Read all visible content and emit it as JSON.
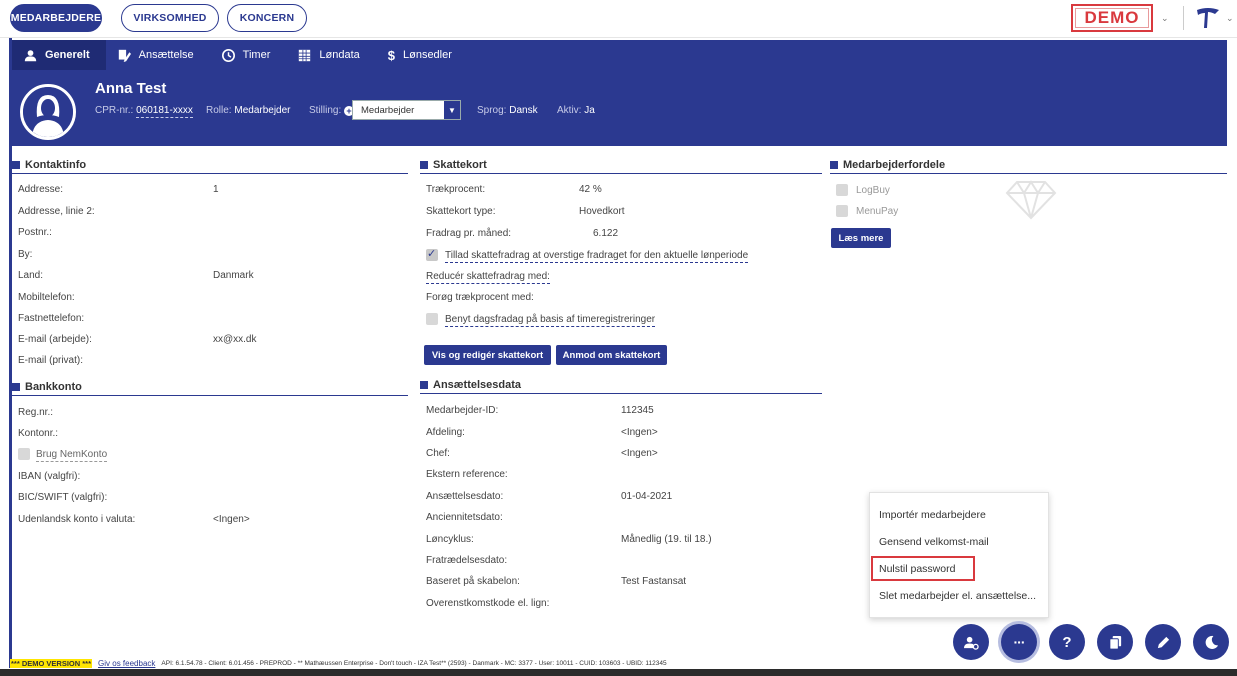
{
  "top_tabs": [
    {
      "label": "MEDARBEJDERE",
      "active": true
    },
    {
      "label": "VIRKSOMHED",
      "active": false
    },
    {
      "label": "KONCERN",
      "active": false
    }
  ],
  "demo_badge": "DEMO",
  "brand_color": "#2b3990",
  "highlight_color": "#d9393e",
  "tabs": [
    {
      "label": "Generelt",
      "icon": "user-icon",
      "active": true
    },
    {
      "label": "Ansættelse",
      "icon": "edit-document-icon",
      "active": false
    },
    {
      "label": "Timer",
      "icon": "clock-icon",
      "active": false
    },
    {
      "label": "Løndata",
      "icon": "table-icon",
      "active": false
    },
    {
      "label": "Lønsedler",
      "icon": "dollar-icon",
      "active": false
    }
  ],
  "employee": {
    "name": "Anna Test",
    "cpr_label": "CPR-nr.:",
    "cpr_value": "060181-xxxx",
    "rolle_label": "Rolle:",
    "rolle_value": "Medarbejder",
    "stilling_label": "Stilling:",
    "stilling_value": "Medarbejder",
    "sprog_label": "Sprog:",
    "sprog_value": "Dansk",
    "aktiv_label": "Aktiv:",
    "aktiv_value": "Ja"
  },
  "kontaktinfo": {
    "title": "Kontaktinfo",
    "rows": [
      {
        "label": "Addresse:",
        "value": "1"
      },
      {
        "label": "Addresse, linie 2:",
        "value": ""
      },
      {
        "label": "Postnr.:",
        "value": ""
      },
      {
        "label": "By:",
        "value": ""
      },
      {
        "label": "Land:",
        "value": "Danmark"
      },
      {
        "label": "Mobiltelefon:",
        "value": ""
      },
      {
        "label": "Fastnettelefon:",
        "value": ""
      },
      {
        "label": "E-mail (arbejde):",
        "value": "xx@xx.dk"
      },
      {
        "label": "E-mail (privat):",
        "value": ""
      }
    ]
  },
  "bankkonto": {
    "title": "Bankkonto",
    "regnr": "Reg.nr.:",
    "kontonr": "Kontonr.:",
    "nemkonto": "Brug NemKonto",
    "iban": "IBAN (valgfri):",
    "bic": "BIC/SWIFT (valgfri):",
    "udenlandsk_label": "Udenlandsk konto i valuta:",
    "udenlandsk_value": "<Ingen>"
  },
  "skattekort": {
    "title": "Skattekort",
    "traek_label": "Trækprocent:",
    "traek_value": "42 %",
    "type_label": "Skattekort type:",
    "type_value": "Hovedkort",
    "fradrag_label": "Fradrag pr. måned:",
    "fradrag_value": "6.122",
    "tillad": "Tillad skattefradrag at overstige fradraget for den aktuelle lønperiode",
    "reducer": "Reducér skattefradrag med:",
    "forog": "Forøg trækprocent med:",
    "benyt": "Benyt dagsfradag på basis af timeregistreringer",
    "btn_vis": "Vis og redigér skattekort",
    "btn_anmod": "Anmod om skattekort"
  },
  "ansaettelse": {
    "title": "Ansættelsesdata",
    "rows": [
      {
        "label": "Medarbejder-ID:",
        "value": "112345"
      },
      {
        "label": "Afdeling:",
        "value": "<Ingen>"
      },
      {
        "label": "Chef:",
        "value": "<Ingen>"
      },
      {
        "label": "Ekstern reference:",
        "value": ""
      },
      {
        "label": "Ansættelsesdato:",
        "value": "01-04-2021"
      },
      {
        "label": "Anciennitetsdato:",
        "value": ""
      },
      {
        "label": "Løncyklus:",
        "value": "Månedlig (19. til 18.)"
      },
      {
        "label": "Fratrædelsesdato:",
        "value": ""
      },
      {
        "label": "Baseret på skabelon:",
        "value": "Test Fastansat"
      },
      {
        "label": "Overenstkomstkode el. lign:",
        "value": ""
      }
    ]
  },
  "fordele": {
    "title": "Medarbejderfordele",
    "items": [
      "LogBuy",
      "MenuPay"
    ],
    "btn": "Læs mere"
  },
  "menu": {
    "items": [
      "Importér medarbejdere",
      "Gensend velkomst-mail",
      "Nulstil password",
      "Slet medarbejder el. ansættelse..."
    ]
  },
  "fabs": [
    {
      "name": "user-settings-icon"
    },
    {
      "name": "more-icon",
      "label": "···"
    },
    {
      "name": "help-icon",
      "label": "?"
    },
    {
      "name": "copy-icon"
    },
    {
      "name": "pencil-icon"
    },
    {
      "name": "moon-icon"
    }
  ],
  "footer": {
    "demo_version": "*** DEMO VERSION ***",
    "feedback": "Giv os feedback",
    "info": "API: 6.1.54.78 - Client: 6.01.456 - PREPROD - ** Mathæussen Enterprise - Don't touch - IZA Test** (2593) - Danmark - MC: 3377 - User: 10011 - CUID: 103603 - UBID: 112345"
  }
}
